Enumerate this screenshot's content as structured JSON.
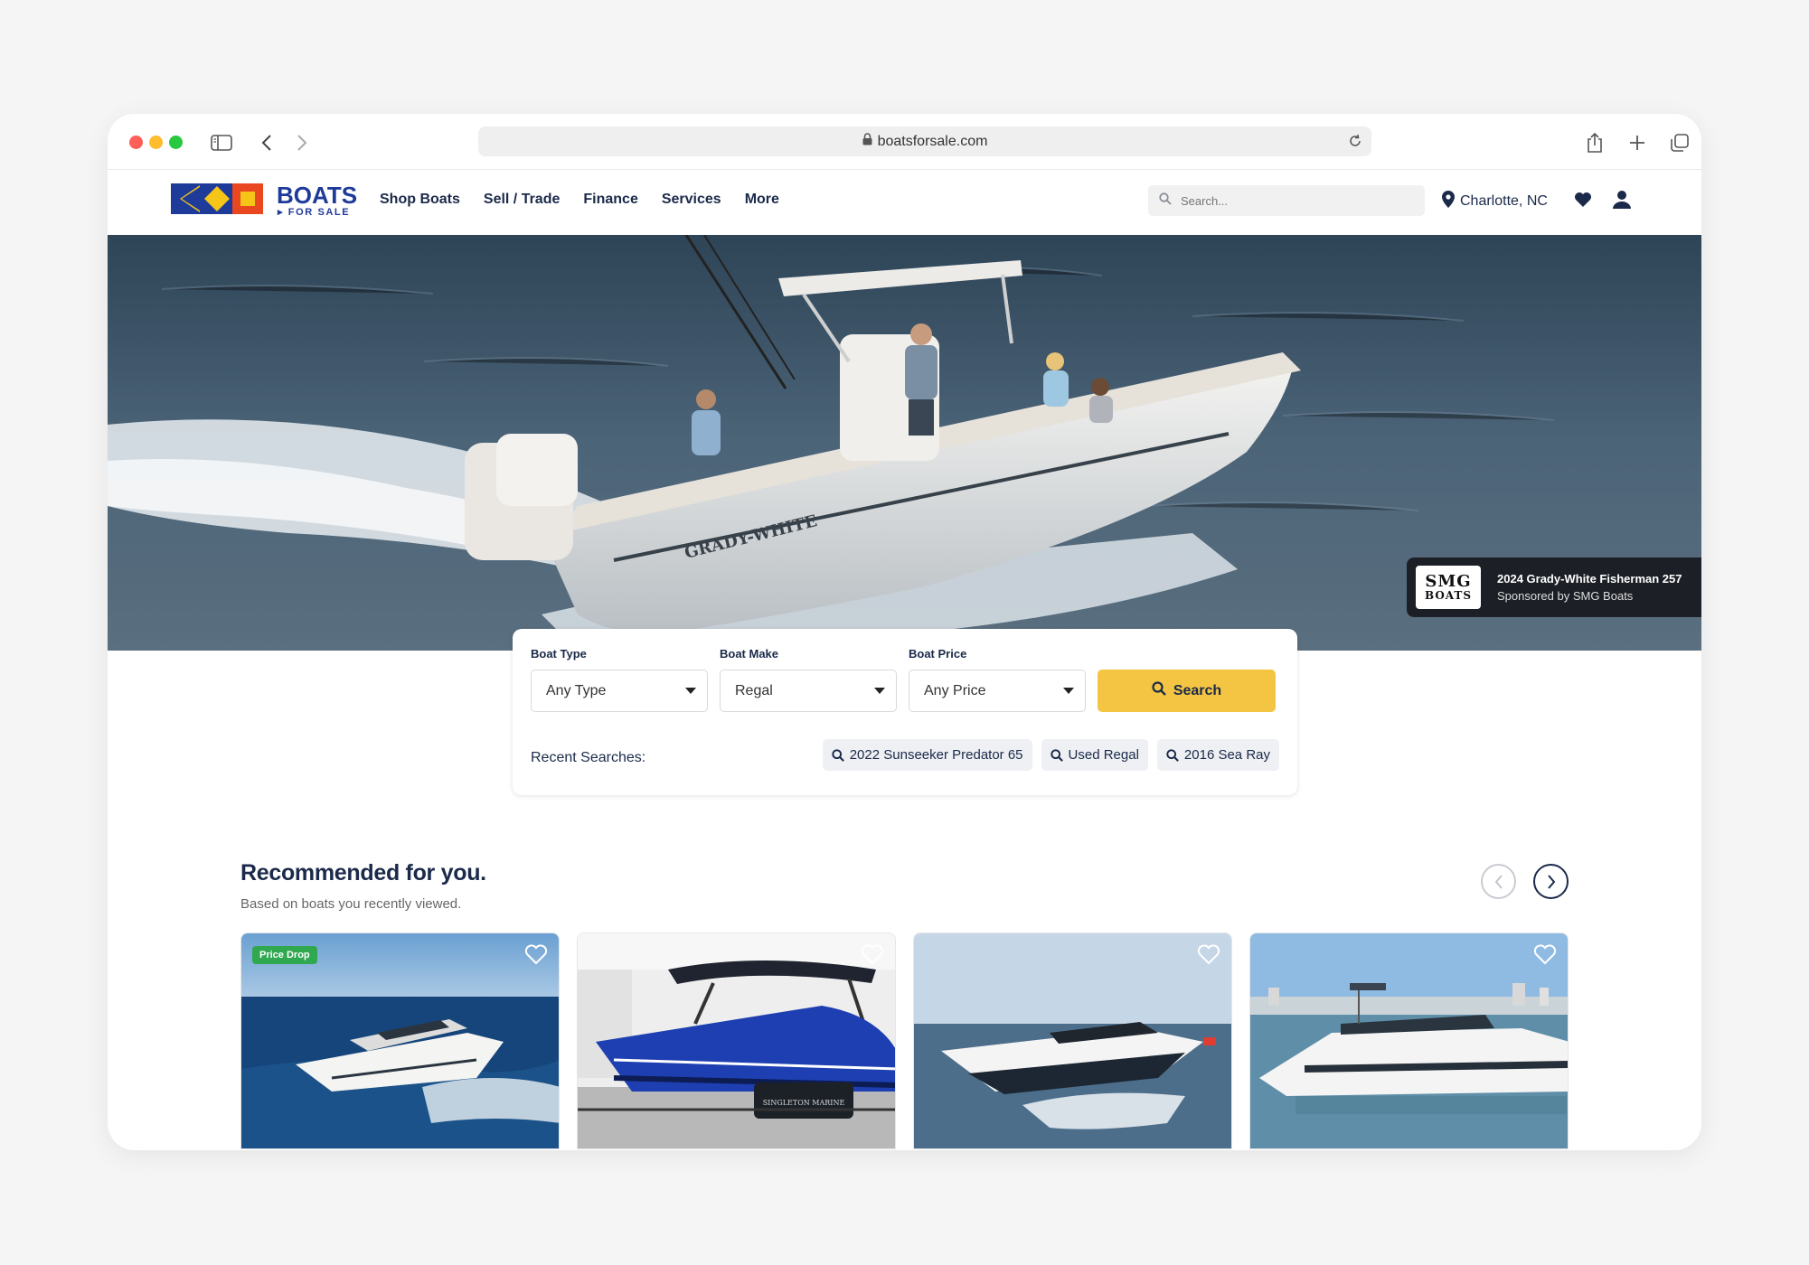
{
  "browser": {
    "url": "boatsforsale.com"
  },
  "site": {
    "logo_main": "BOATS",
    "logo_sub": "▸ FOR SALE",
    "nav": [
      {
        "label": "Shop Boats"
      },
      {
        "label": "Sell / Trade"
      },
      {
        "label": "Finance"
      },
      {
        "label": "Services"
      },
      {
        "label": "More"
      }
    ],
    "search_placeholder": "Search...",
    "location": "Charlotte, NC"
  },
  "hero": {
    "sponsor_logo_top": "SMG",
    "sponsor_logo_bottom": "BOATS",
    "listing_title": "2024 Grady-White Fisherman 257",
    "sponsor_line": "Sponsored by SMG Boats",
    "hull_text": "GRADY-WHITE"
  },
  "search": {
    "fields": [
      {
        "label": "Boat Type",
        "value": "Any Type"
      },
      {
        "label": "Boat Make",
        "value": "Regal"
      },
      {
        "label": "Boat Price",
        "value": "Any Price"
      }
    ],
    "button_label": "Search",
    "recent_label": "Recent Searches:",
    "recent": [
      {
        "label": "2022 Sunseeker Predator 65"
      },
      {
        "label": "Used Regal"
      },
      {
        "label": "2016 Sea Ray"
      }
    ]
  },
  "recommended": {
    "title": "Recommended for you.",
    "subtitle": "Based on boats you recently viewed.",
    "cards": [
      {
        "badge": "Price Drop",
        "icon": "yacht-photo"
      },
      {
        "badge": "",
        "icon": "blue-bowrider-photo",
        "trailer_text": "SINGLETON MARINE"
      },
      {
        "badge": "",
        "icon": "sport-yacht-photo"
      },
      {
        "badge": "",
        "icon": "flybridge-yacht-photo"
      }
    ]
  },
  "colors": {
    "navy": "#1b2a4a",
    "accent_yellow": "#f4c542",
    "badge_green": "#2fa84f",
    "logo_blue": "#1f3b9a",
    "logo_red": "#e8471f"
  }
}
